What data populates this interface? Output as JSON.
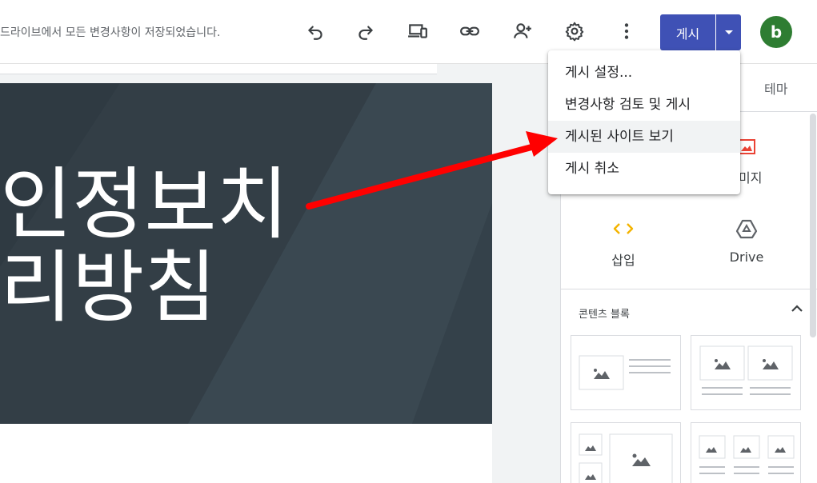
{
  "header": {
    "save_status": "드라이브에서 모든 변경사항이 저장되었습니다.",
    "publish_label": "게시",
    "avatar_letter": "b",
    "icons": [
      "undo-icon",
      "redo-icon",
      "preview-devices-icon",
      "link-icon",
      "add-person-icon",
      "gear-icon",
      "more-vert-icon"
    ]
  },
  "hero": {
    "title_line1": "인정보치",
    "title_line2": "리방침"
  },
  "publish_menu": {
    "items": [
      {
        "label": "게시 설정..."
      },
      {
        "label": "변경사항 검토 및 게시"
      },
      {
        "label": "게시된 사이트 보기"
      },
      {
        "label": "게시 취소"
      }
    ],
    "hovered_index": 2
  },
  "panel": {
    "tab_theme": "테마",
    "image_label_partial": "미지",
    "insert_label": "삽입",
    "drive_label": "Drive",
    "content_blocks_title": "콘텐츠 블록"
  },
  "colors": {
    "publish_blue": "#3f51b5",
    "avatar_green": "#2e7d32",
    "hero_bg": "#37444d",
    "arrow_red": "#ff0000",
    "insert_yellow": "#f4b400",
    "image_red": "#ea4335"
  }
}
